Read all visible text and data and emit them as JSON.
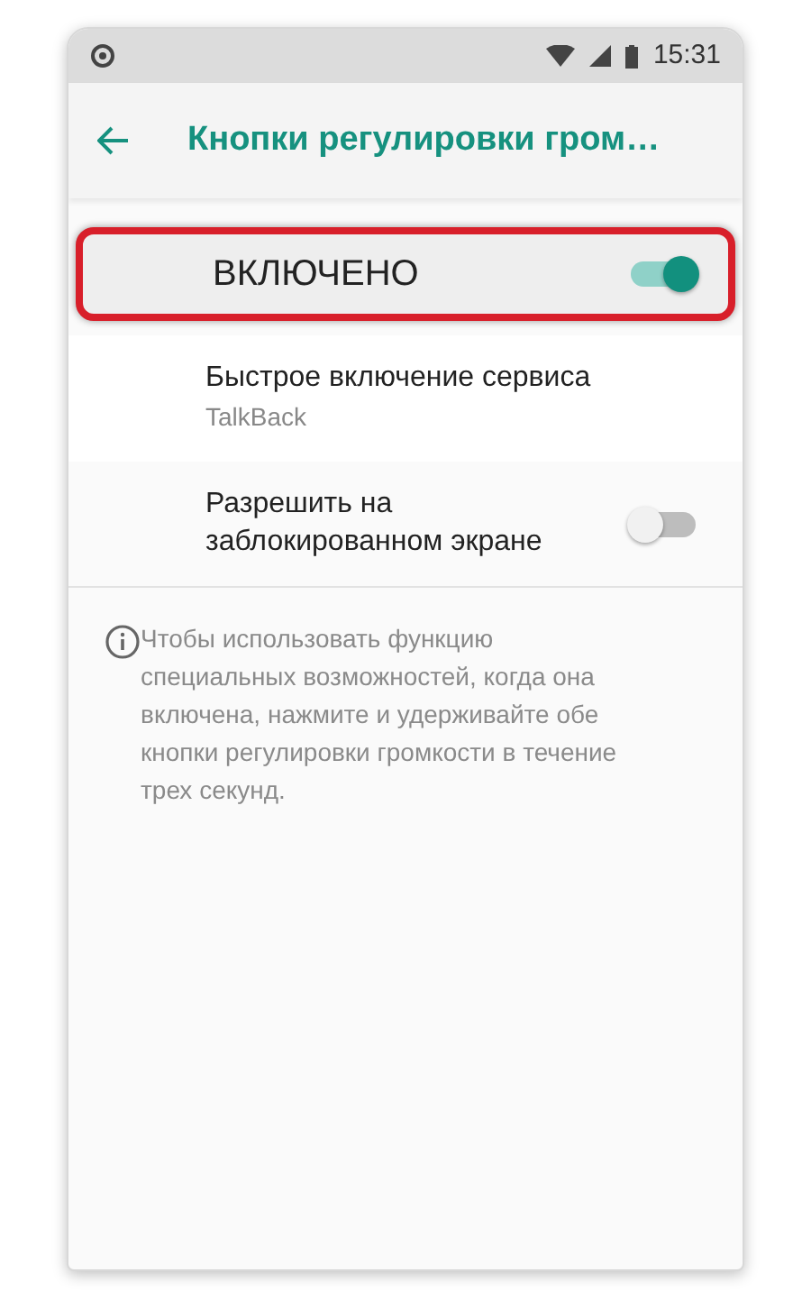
{
  "status_bar": {
    "time": "15:31"
  },
  "app_bar": {
    "title": "Кнопки регулировки гром…"
  },
  "master_switch": {
    "label": "ВКЛЮЧЕНО",
    "on": true,
    "highlighted": true
  },
  "settings": [
    {
      "kind": "link",
      "title": "Быстрое включение сервиса",
      "subtitle": "TalkBack"
    },
    {
      "kind": "switch",
      "title": "Разрешить на заблокированном экране",
      "on": false
    }
  ],
  "info": {
    "text": "Чтобы использовать функцию специальных возможностей, когда она включена, нажмите и удерживайте обе кнопки регулировки громкости в течение трех секунд."
  }
}
